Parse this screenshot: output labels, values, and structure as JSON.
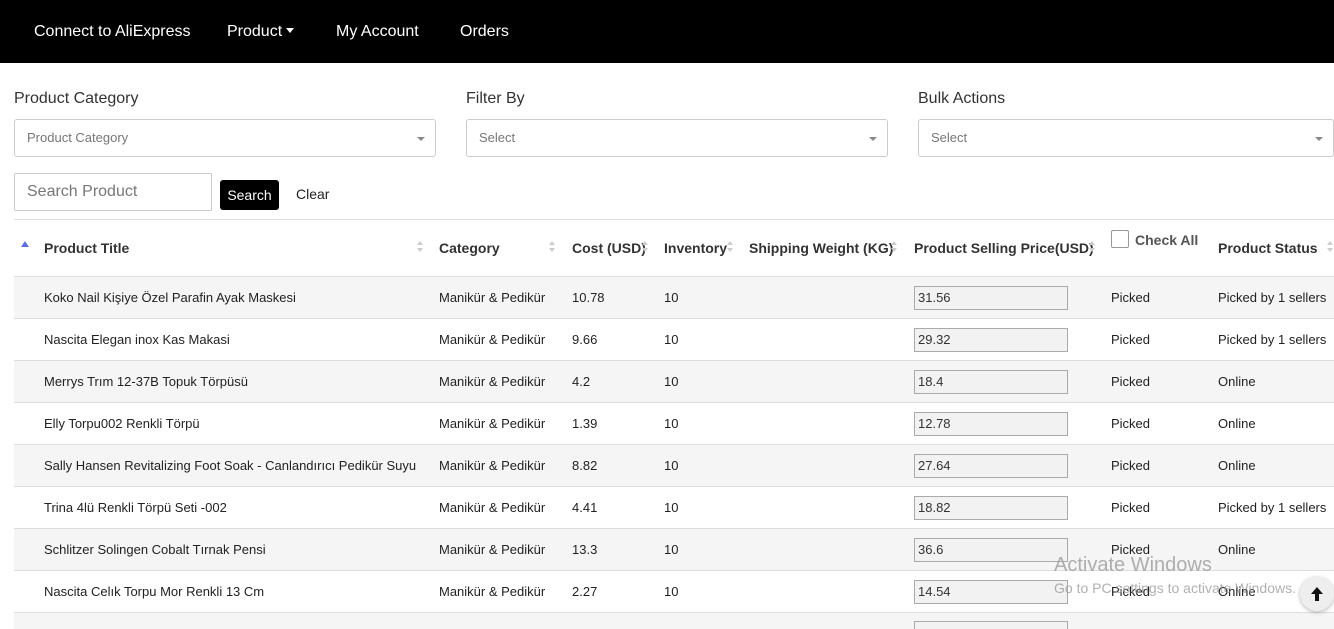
{
  "nav": {
    "items": [
      {
        "label": "Connect to AliExpress"
      },
      {
        "label": "Product"
      },
      {
        "label": "My Account"
      },
      {
        "label": "Orders"
      }
    ]
  },
  "filters": {
    "category": {
      "label": "Product Category",
      "placeholder": "Product Category"
    },
    "filter_by": {
      "label": "Filter By",
      "placeholder": "Select"
    },
    "bulk_actions": {
      "label": "Bulk Actions",
      "placeholder": "Select"
    }
  },
  "search": {
    "placeholder": "Search Product",
    "button": "Search",
    "clear": "Clear"
  },
  "table": {
    "headers": {
      "title": "Product Title",
      "category": "Category",
      "cost": "Cost (USD)",
      "inventory": "Inventory",
      "shipping": "Shipping Weight (KG)",
      "price": "Product Selling Price(USD)",
      "check_all": "Check All",
      "status": "Product Status"
    },
    "rows": [
      {
        "title": "Koko Nail Kişiye Özel Parafin Ayak Maskesi",
        "category": "Manikür & Pedikür",
        "cost": "10.78",
        "inventory": "10",
        "shipping": "",
        "price": "31.56",
        "picked": "Picked",
        "status": "Picked by 1 sellers"
      },
      {
        "title": "Nascita Elegan inox Kas Makasi",
        "category": "Manikür & Pedikür",
        "cost": "9.66",
        "inventory": "10",
        "shipping": "",
        "price": "29.32",
        "picked": "Picked",
        "status": "Picked by 1 sellers"
      },
      {
        "title": "Merrys Trım 12-37B Topuk Törpüsü",
        "category": "Manikür & Pedikür",
        "cost": "4.2",
        "inventory": "10",
        "shipping": "",
        "price": "18.4",
        "picked": "Picked",
        "status": "Online"
      },
      {
        "title": "Elly Torpu002 Renkli Törpü",
        "category": "Manikür & Pedikür",
        "cost": "1.39",
        "inventory": "10",
        "shipping": "",
        "price": "12.78",
        "picked": "Picked",
        "status": "Online"
      },
      {
        "title": "Sally Hansen Revitalizing Foot Soak - Canlandırıcı Pedikür Suyu",
        "category": "Manikür & Pedikür",
        "cost": "8.82",
        "inventory": "10",
        "shipping": "",
        "price": "27.64",
        "picked": "Picked",
        "status": "Online"
      },
      {
        "title": "Trina 4lü Renkli Törpü Seti -002",
        "category": "Manikür & Pedikür",
        "cost": "4.41",
        "inventory": "10",
        "shipping": "",
        "price": "18.82",
        "picked": "Picked",
        "status": "Picked by 1 sellers"
      },
      {
        "title": "Schlitzer Solingen Cobalt Tırnak Pensi",
        "category": "Manikür & Pedikür",
        "cost": "13.3",
        "inventory": "10",
        "shipping": "",
        "price": "36.6",
        "picked": "Picked",
        "status": "Online"
      },
      {
        "title": "Nascita Celık Torpu Mor Renkli 13 Cm",
        "category": "Manikür & Pedikür",
        "cost": "2.27",
        "inventory": "10",
        "shipping": "",
        "price": "14.54",
        "picked": "Picked",
        "status": "Online"
      }
    ]
  },
  "watermark": {
    "line1": "Activate Windows",
    "line2": "Go to PC settings to activate Windows."
  },
  "icons": {
    "scroll_top": "arrow-up-icon",
    "dropdown": "caret-down-icon",
    "sort": "sort-icon"
  }
}
